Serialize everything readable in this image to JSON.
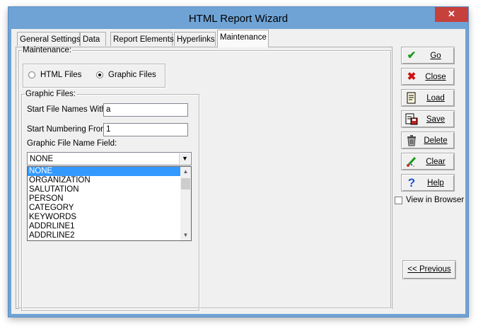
{
  "window": {
    "title": "HTML Report Wizard",
    "close_glyph": "✕"
  },
  "tabs": [
    {
      "label": "General Settings"
    },
    {
      "label": "Data"
    },
    {
      "label": "Report Elements"
    },
    {
      "label": "Hyperlinks"
    },
    {
      "label": "Maintenance",
      "active": true
    }
  ],
  "maintenance": {
    "legend": "Maintenance:",
    "options": [
      {
        "label": "HTML Files",
        "checked": false
      },
      {
        "label": "Graphic Files",
        "checked": true
      }
    ]
  },
  "graphic_files": {
    "legend": "Graphic Files:",
    "start_names_label": "Start File Names With:",
    "start_names_value": "a",
    "start_numbering_label": "Start Numbering From:",
    "start_numbering_value": "1",
    "name_field_label": "Graphic File Name Field:",
    "name_field_value": "NONE",
    "name_field_options": [
      "NONE",
      "ORGANIZATION",
      "SALUTATION",
      "PERSON",
      "CATEGORY",
      "KEYWORDS",
      "ADDRLINE1",
      "ADDRLINE2"
    ],
    "selected_option": "NONE"
  },
  "side_buttons": [
    {
      "label": "Go",
      "icon": "checkmark-icon",
      "color": "#1a9a1a"
    },
    {
      "label": "Close",
      "icon": "close-x-icon",
      "color": "#d01010"
    },
    {
      "label": "Load",
      "icon": "load-document-icon",
      "color": "#000000"
    },
    {
      "label": "Save",
      "icon": "save-document-icon",
      "color": "#000000"
    },
    {
      "label": "Delete",
      "icon": "trash-can-icon",
      "color": "#000000"
    },
    {
      "label": "Clear",
      "icon": "eraser-icon",
      "color": "#1a9a1a"
    },
    {
      "label": "Help",
      "icon": "question-mark-icon",
      "color": "#1f55c8"
    }
  ],
  "view_in_browser": {
    "label": "View in Browser",
    "checked": false
  },
  "previous_button": {
    "label": "<< Previous"
  },
  "colors": {
    "titlebar": "#6fa3d6",
    "close": "#c7413c",
    "selection": "#3399ff",
    "face": "#f0f0f0"
  }
}
